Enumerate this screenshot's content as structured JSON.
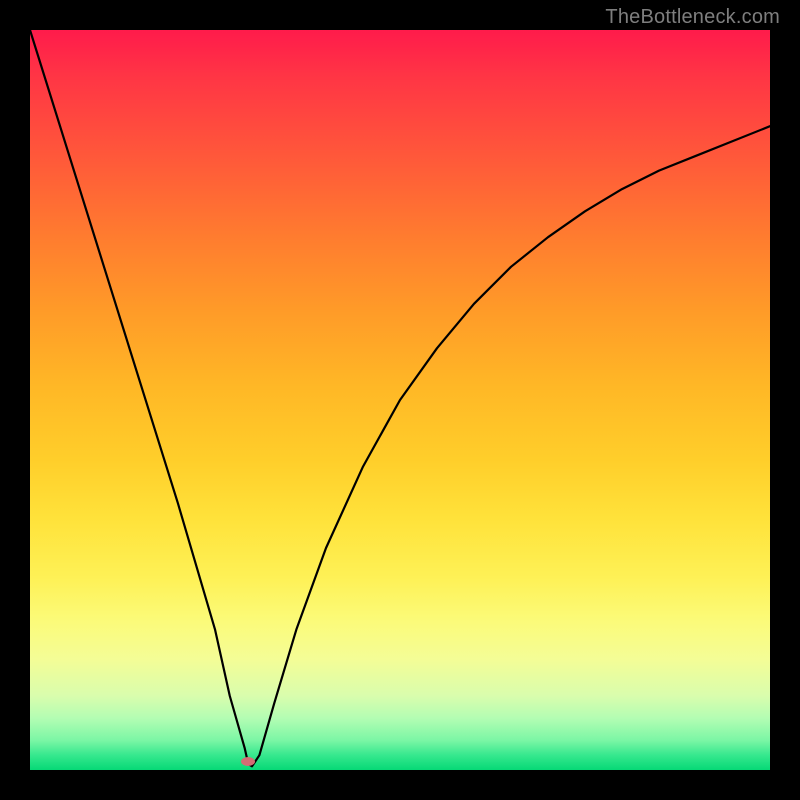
{
  "watermark": "TheBottleneck.com",
  "chart_data": {
    "type": "line",
    "title": "",
    "xlabel": "",
    "ylabel": "",
    "xlim": [
      0,
      100
    ],
    "ylim": [
      0,
      100
    ],
    "grid": false,
    "legend": false,
    "series": [
      {
        "name": "bottleneck-curve",
        "x": [
          0,
          5,
          10,
          15,
          20,
          25,
          27,
          29,
          29.5,
          30,
          31,
          33,
          36,
          40,
          45,
          50,
          55,
          60,
          65,
          70,
          75,
          80,
          85,
          90,
          95,
          100
        ],
        "values": [
          100,
          84,
          68,
          52,
          36,
          19,
          10,
          3,
          0.8,
          0.5,
          2,
          9,
          19,
          30,
          41,
          50,
          57,
          63,
          68,
          72,
          75.5,
          78.5,
          81,
          83,
          85,
          87
        ]
      }
    ],
    "marker": {
      "x": 29.5,
      "y": 0.8,
      "color": "#d36d74"
    },
    "background_gradient": [
      "#ff1b4b",
      "#ffce2a",
      "#fef156",
      "#06d976"
    ]
  }
}
